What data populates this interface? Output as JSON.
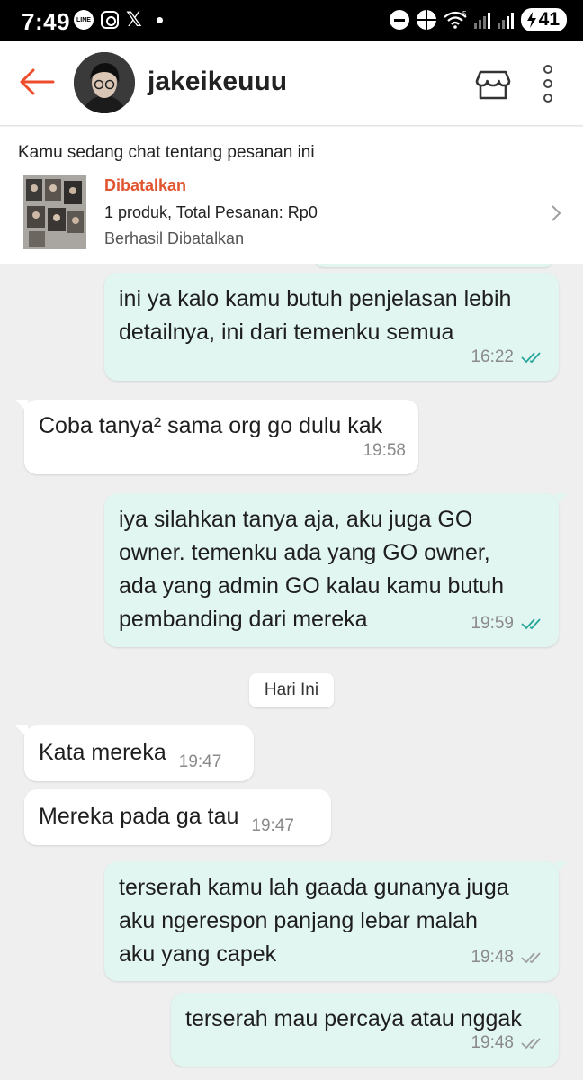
{
  "status_bar": {
    "time": "7:49",
    "battery": "41",
    "signal_label": "5",
    "icons": [
      "line-icon",
      "instagram-icon",
      "x-icon",
      "notification-dot",
      "dnd-icon",
      "ball-icon",
      "wifi-icon",
      "signal-icon",
      "battery-charging-icon"
    ]
  },
  "header": {
    "back_icon": "arrow-left-icon",
    "username": "jakeikeuuu",
    "shop_icon": "shop-icon",
    "more_icon": "more-vertical-icon",
    "accent_color": "#ee4d2d"
  },
  "order": {
    "title": "Kamu sedang chat tentang pesanan ini",
    "status": "Dibatalkan",
    "summary": "1 produk, Total Pesanan: Rp0",
    "note": "Berhasil Dibatalkan",
    "status_color": "#e0552f"
  },
  "chat": {
    "date_separator": "Hari Ini",
    "messages": [
      {
        "side": "out",
        "lines": [
          "ini ya kalo kamu butuh penjelasan lebih",
          "detailnya, ini dari temenku semua"
        ],
        "time": "16:22",
        "read": true
      },
      {
        "side": "in",
        "text": "Coba tanya² sama org go dulu kak",
        "time": "19:58"
      },
      {
        "side": "out",
        "lines": [
          "iya silahkan tanya aja, aku juga GO",
          "owner. temenku ada yang GO owner,",
          "ada yang admin GO kalau kamu butuh",
          "pembanding dari mereka"
        ],
        "time": "19:59",
        "read": true
      },
      {
        "side": "in",
        "text": "Kata mereka",
        "time": "19:47"
      },
      {
        "side": "in",
        "text": "Mereka pada ga tau",
        "time": "19:47"
      },
      {
        "side": "out",
        "lines": [
          "terserah kamu lah gaada gunanya juga",
          "aku ngerespon panjang lebar malah",
          "aku yang capek"
        ],
        "time": "19:48",
        "read": false
      },
      {
        "side": "out",
        "lines": [
          "terserah mau percaya atau nggak"
        ],
        "time": "19:48",
        "read": false
      }
    ],
    "colors": {
      "outgoing": "#e1f5f1",
      "incoming": "#ffffff",
      "read_tick": "#26a69a",
      "sent_tick": "#9e9e9e"
    }
  }
}
